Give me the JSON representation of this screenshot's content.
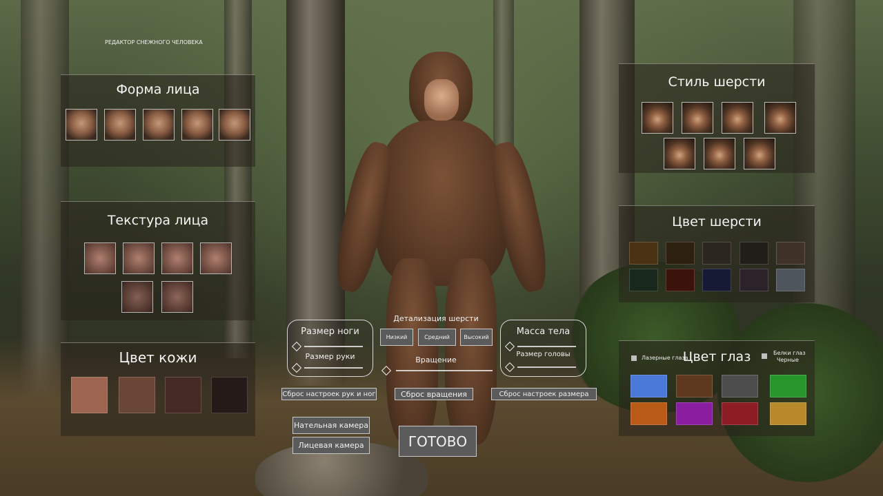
{
  "editor_title": "РЕДАКТОР СНЕЖНОГО ЧЕЛОВЕКА",
  "face_shape": {
    "title": "Форма лица",
    "count": 5
  },
  "face_texture": {
    "title": "Текстура лица",
    "count": 6
  },
  "skin_color": {
    "title": "Цвет кожи",
    "colors": [
      "#9d6450",
      "#6a4636",
      "#442a22",
      "#261a18"
    ]
  },
  "fur_style": {
    "title": "Стиль шерсти",
    "count": 7
  },
  "fur_color": {
    "title": "Цвет шерсти",
    "colors": [
      "#4a3212",
      "#2e200e",
      "#2b2620",
      "#211e1a",
      "#3f3228",
      "#18281c",
      "#3c130a",
      "#161a34",
      "#2c222a",
      "#4e555c"
    ]
  },
  "eye_color": {
    "title": "Цвет глаз",
    "laser_label": "Лазерные глаза",
    "white_label": "Белки глаз",
    "black_label": "Черные",
    "colors": [
      "#4a79d8",
      "#5e391d",
      "#4d4d4d",
      "#26962a",
      "#b95a16",
      "#8a1ea0",
      "#8c1d24",
      "#b88a2c"
    ]
  },
  "sliders": {
    "foot_size": "Размер ноги",
    "arm_size": "Размер руки",
    "fur_detail": "Детализация шерсти",
    "detail_low": "Низкий",
    "detail_mid": "Средний",
    "detail_high": "Высокий",
    "rotation": "Вращение",
    "body_mass": "Масса тела",
    "head_size": "Размер головы"
  },
  "buttons": {
    "reset_limbs": "Сброс настроек рук и ног",
    "reset_rotation": "Сброс вращения",
    "reset_size": "Сброс настроек размера",
    "body_camera": "Нательная камера",
    "face_camera": "Лицевая камера",
    "done": "ГОТОВО"
  }
}
